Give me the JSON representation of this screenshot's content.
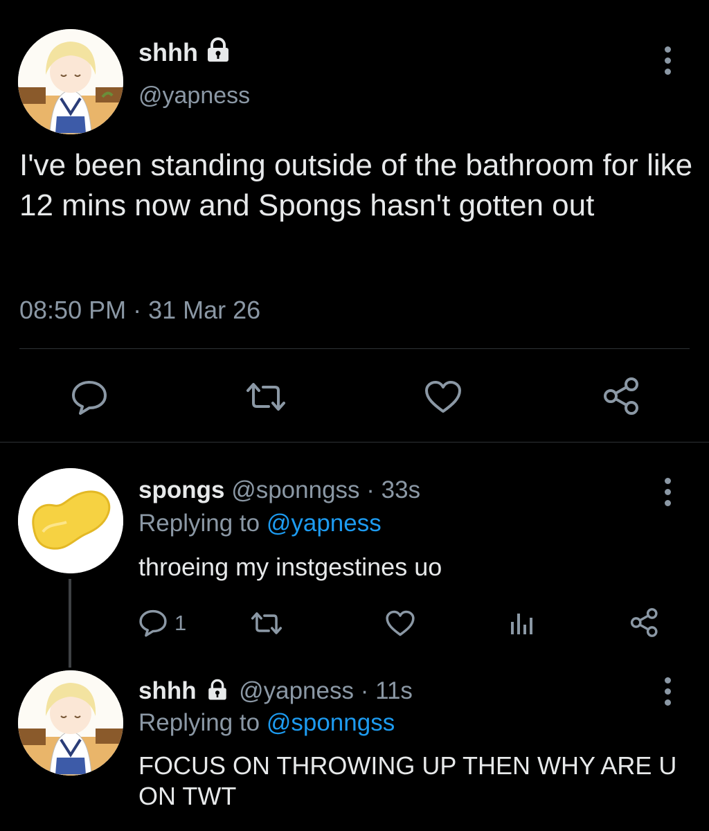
{
  "main_tweet": {
    "display_name": "shhh",
    "handle": "@yapness",
    "text": "I've been standing outside of the bathroom for like 12 mins now and Spongs hasn't gotten out",
    "timestamp": "08:50 PM · 31 Mar 26",
    "actions": [
      "reply-icon",
      "retweet-icon",
      "like-icon",
      "share-icon"
    ]
  },
  "replies": [
    {
      "display_name": "spongs",
      "handle": "@sponngss",
      "age": "· 33s",
      "replying_prefix": "Replying to",
      "replying_to": "@yapness",
      "text": "throeing my instgestines uo",
      "reply_count": "1"
    },
    {
      "display_name": "shhh",
      "handle": "@yapness",
      "age": "· 11s",
      "replying_prefix": "Replying to",
      "replying_to": "@sponngss",
      "text": "FOCUS ON THROWING UP THEN WHY ARE U ON TWT"
    }
  ],
  "colors": {
    "background": "#000000",
    "muted": "#8b98a5",
    "link": "#1d9bf0",
    "text": "#e7e9ea"
  }
}
